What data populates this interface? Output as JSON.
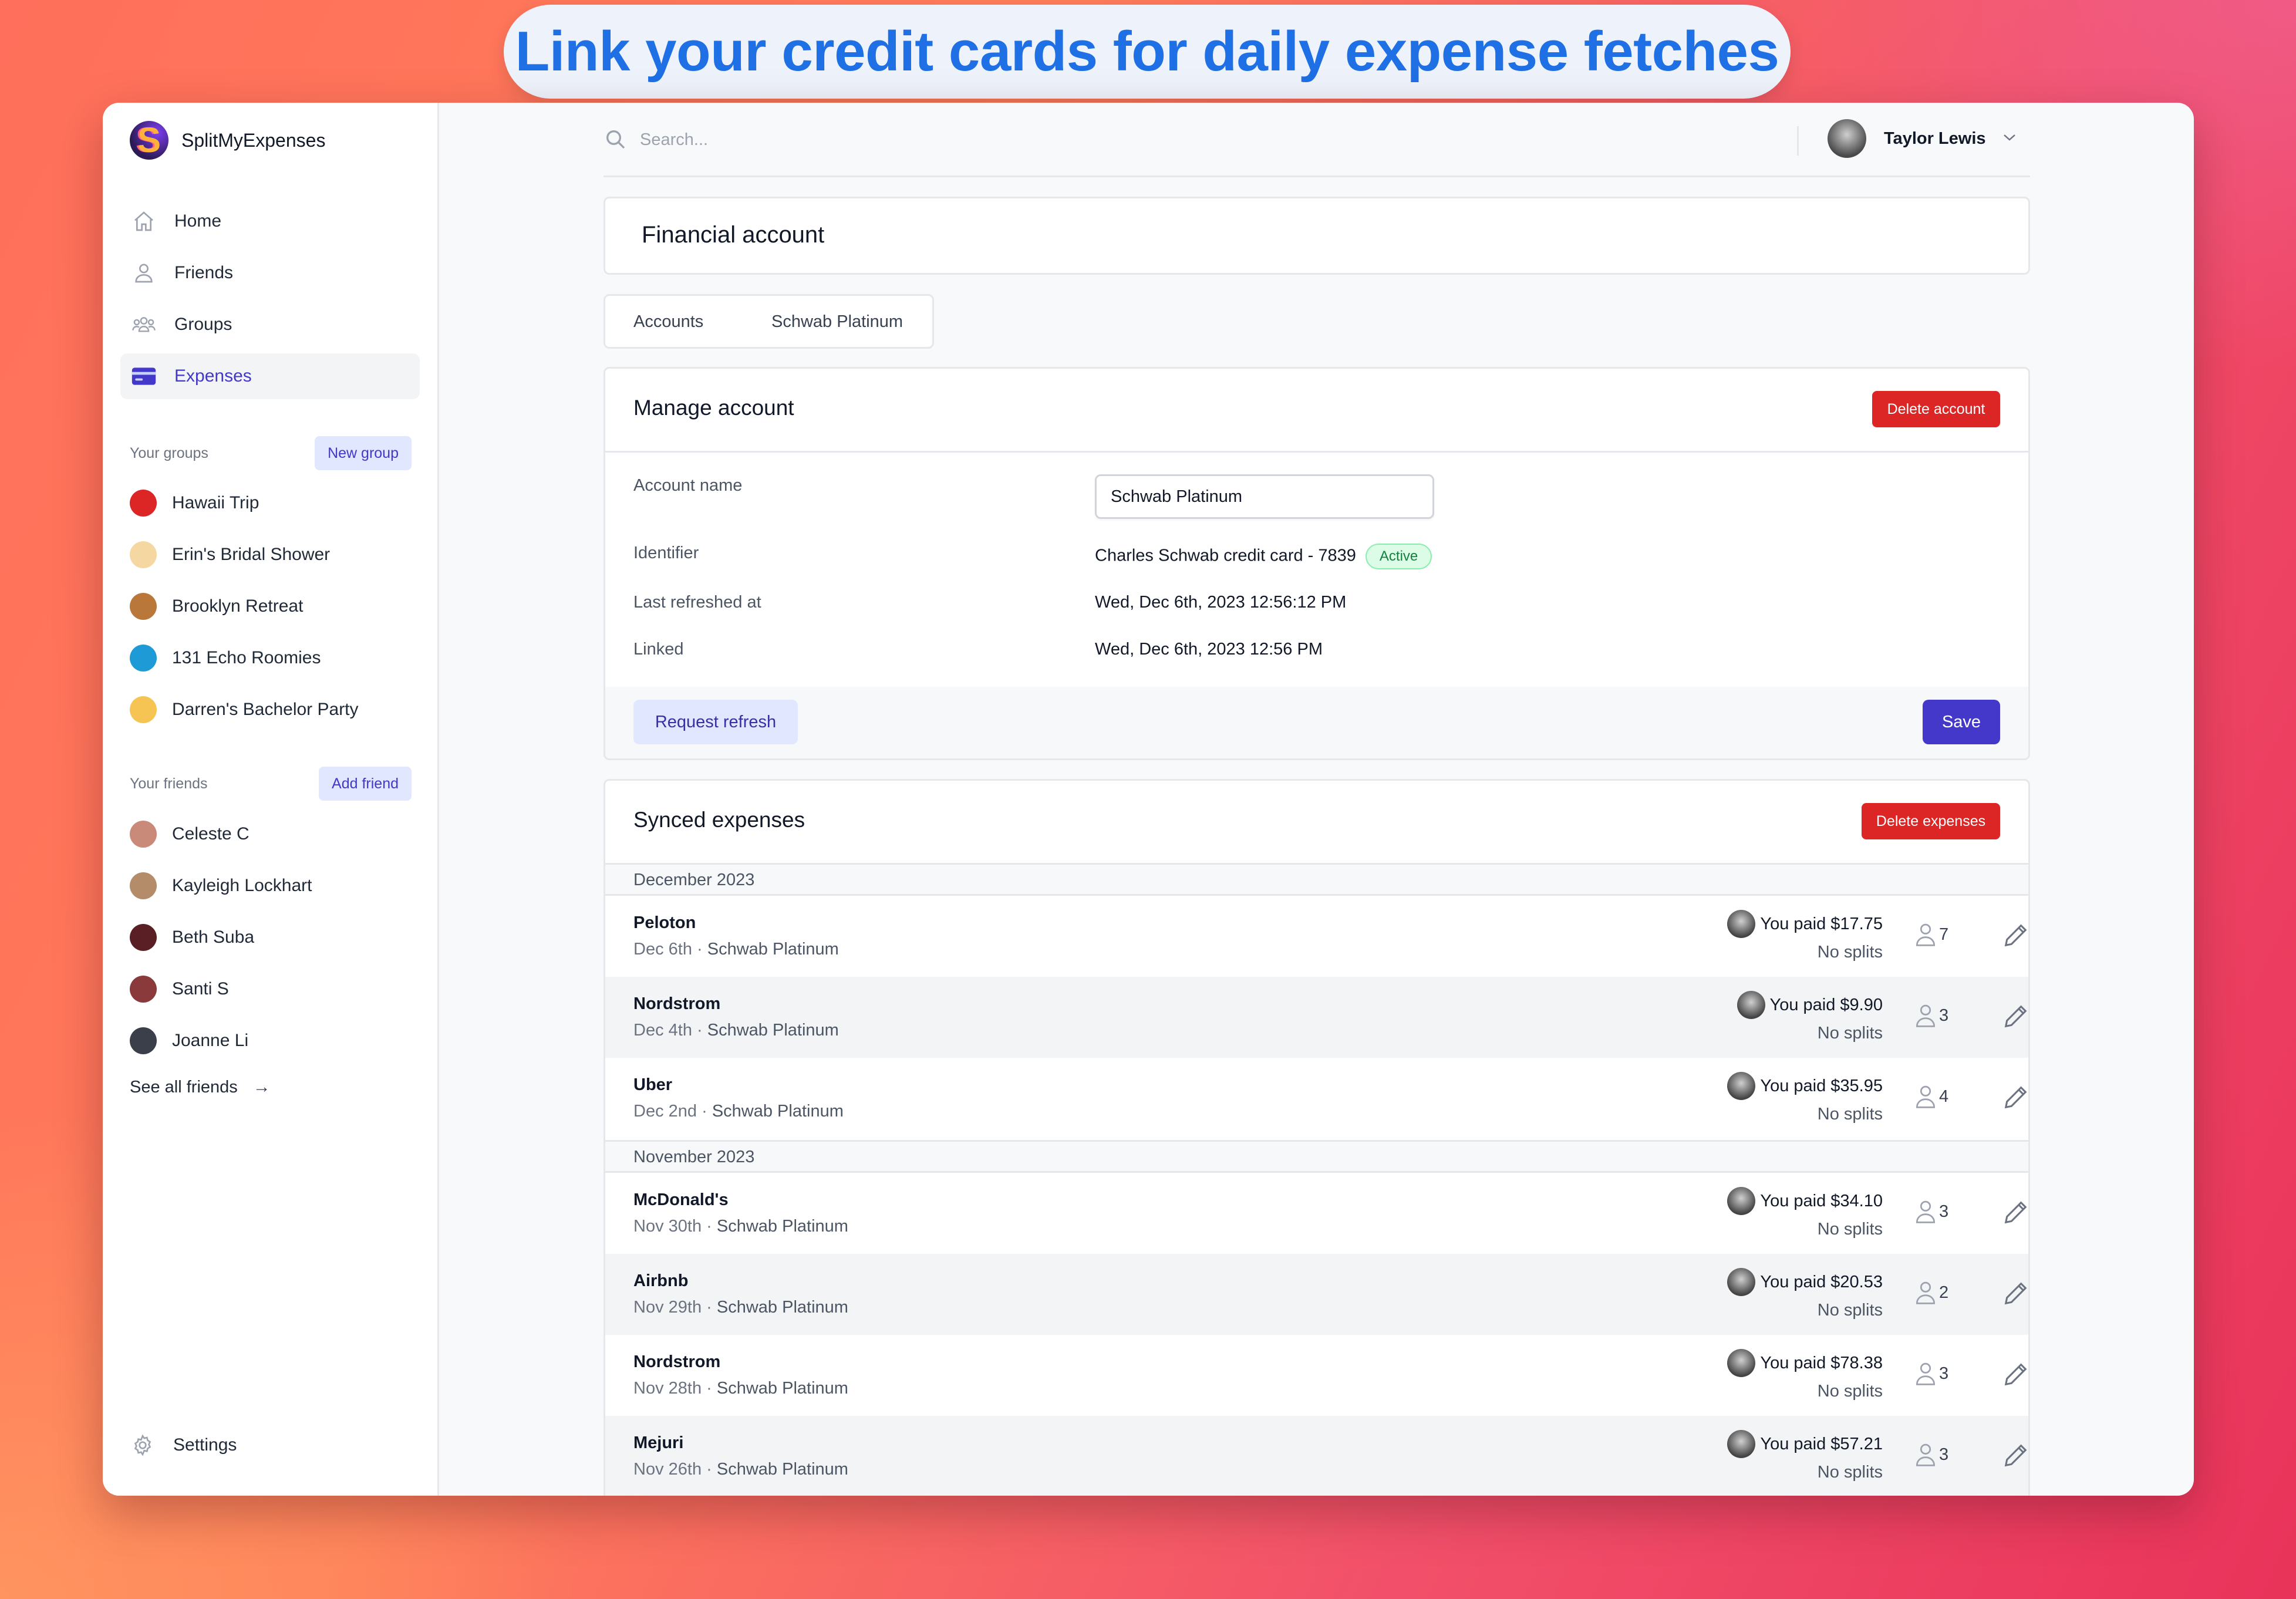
{
  "headline": "Link your credit cards for daily expense fetches",
  "app": {
    "name": "SplitMyExpenses",
    "logo_letter": "S"
  },
  "nav": [
    {
      "label": "Home",
      "icon": "home-icon",
      "active": false
    },
    {
      "label": "Friends",
      "icon": "user-icon",
      "active": false
    },
    {
      "label": "Groups",
      "icon": "users-icon",
      "active": false
    },
    {
      "label": "Expenses",
      "icon": "credit-card-icon",
      "active": true
    }
  ],
  "groups": {
    "heading": "Your groups",
    "button": "New group",
    "items": [
      {
        "label": "Hawaii Trip",
        "color": "#dc2626"
      },
      {
        "label": "Erin's Bridal Shower",
        "color": "#f5d7a1"
      },
      {
        "label": "Brooklyn Retreat",
        "color": "#b9773a"
      },
      {
        "label": "131 Echo Roomies",
        "color": "#1e9bd7"
      },
      {
        "label": "Darren's Bachelor Party",
        "color": "#f6c453"
      }
    ]
  },
  "friends": {
    "heading": "Your friends",
    "button": "Add friend",
    "items": [
      {
        "label": "Celeste C",
        "color": "#c98a7a"
      },
      {
        "label": "Kayleigh Lockhart",
        "color": "#b48c6a"
      },
      {
        "label": "Beth Suba",
        "color": "#5a1f25"
      },
      {
        "label": "Santi S",
        "color": "#8a3a3a"
      },
      {
        "label": "Joanne Li",
        "color": "#3a3f4a"
      }
    ],
    "see_all": "See all friends",
    "arrow": "→"
  },
  "settings": "Settings",
  "search": {
    "placeholder": "Search..."
  },
  "user": {
    "name": "Taylor Lewis"
  },
  "page_title": "Financial account",
  "breadcrumb": [
    "Accounts",
    "Schwab Platinum"
  ],
  "manage": {
    "title": "Manage account",
    "delete_label": "Delete account",
    "fields": {
      "account_name_label": "Account name",
      "account_name_value": "Schwab Platinum",
      "identifier_label": "Identifier",
      "identifier_value": "Charles Schwab credit card - 7839",
      "status": "Active",
      "last_refreshed_label": "Last refreshed at",
      "last_refreshed_value": "Wed, Dec 6th, 2023 12:56:12 PM",
      "linked_label": "Linked",
      "linked_value": "Wed, Dec 6th, 2023 12:56 PM"
    },
    "refresh_label": "Request refresh",
    "save_label": "Save"
  },
  "synced": {
    "title": "Synced expenses",
    "delete_label": "Delete expenses",
    "months": [
      {
        "label": "December 2023",
        "rows": [
          {
            "merchant": "Peloton",
            "date": "Dec 6th",
            "sep": "·",
            "account": "Schwab Platinum",
            "paid": "You paid $17.75",
            "splits": "No splits",
            "people": "7"
          },
          {
            "merchant": "Nordstrom",
            "date": "Dec 4th",
            "sep": "·",
            "account": "Schwab Platinum",
            "paid": "You paid $9.90",
            "splits": "No splits",
            "people": "3"
          },
          {
            "merchant": "Uber",
            "date": "Dec 2nd",
            "sep": "·",
            "account": "Schwab Platinum",
            "paid": "You paid $35.95",
            "splits": "No splits",
            "people": "4"
          }
        ]
      },
      {
        "label": "November 2023",
        "rows": [
          {
            "merchant": "McDonald's",
            "date": "Nov 30th",
            "sep": "·",
            "account": "Schwab Platinum",
            "paid": "You paid $34.10",
            "splits": "No splits",
            "people": "3"
          },
          {
            "merchant": "Airbnb",
            "date": "Nov 29th",
            "sep": "·",
            "account": "Schwab Platinum",
            "paid": "You paid $20.53",
            "splits": "No splits",
            "people": "2"
          },
          {
            "merchant": "Nordstrom",
            "date": "Nov 28th",
            "sep": "·",
            "account": "Schwab Platinum",
            "paid": "You paid $78.38",
            "splits": "No splits",
            "people": "3"
          },
          {
            "merchant": "Mejuri",
            "date": "Nov 26th",
            "sep": "·",
            "account": "Schwab Platinum",
            "paid": "You paid $57.21",
            "splits": "No splits",
            "people": "3"
          }
        ]
      }
    ]
  },
  "colors": {
    "accent": "#4338ca",
    "danger": "#dc2626",
    "success": "#15803d",
    "headline": "#1f6fe5"
  }
}
